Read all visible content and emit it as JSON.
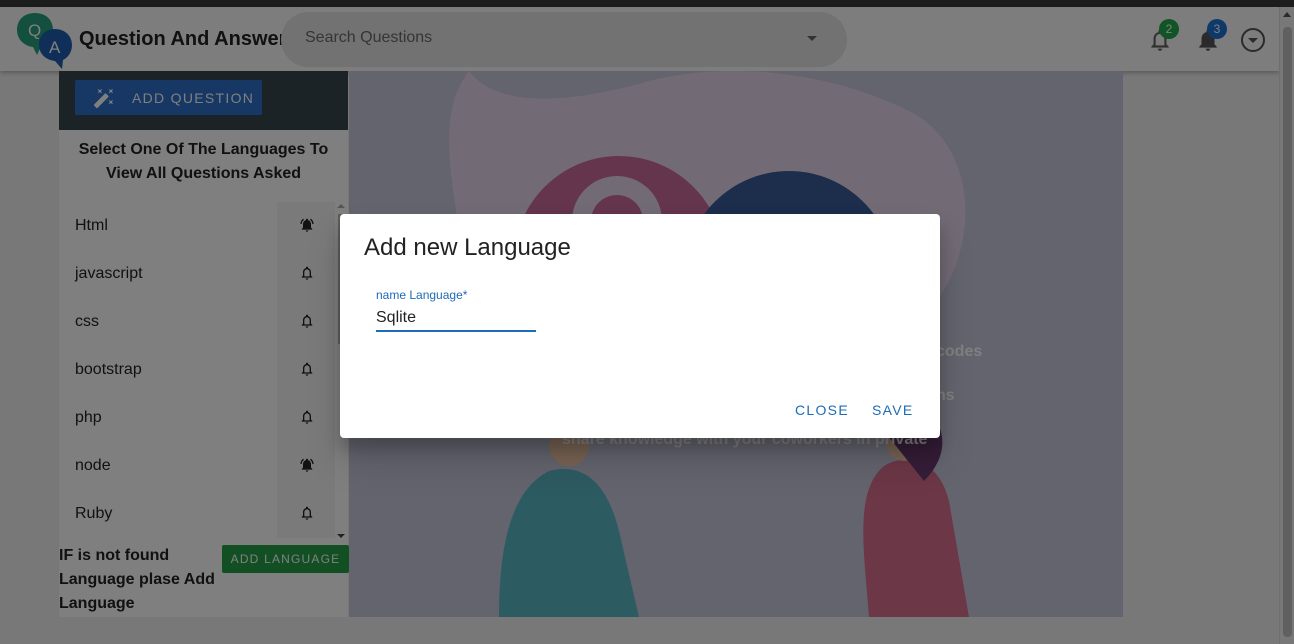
{
  "app": {
    "title": "Question And Answer",
    "logo_letters": [
      "Q",
      "A"
    ]
  },
  "search": {
    "placeholder": "Search Questions"
  },
  "notifications": [
    {
      "icon": "bell-outline-icon",
      "count": "2",
      "badge_color": "#22a84a"
    },
    {
      "icon": "bell-icon",
      "count": "3",
      "badge_color": "#1e73d2"
    }
  ],
  "sidebar": {
    "add_question_label": "ADD QUESTION",
    "heading": "Select One Of The Languages To View All Questions Asked",
    "languages": [
      {
        "name": "Html",
        "bell": "bell-ringing-icon"
      },
      {
        "name": "javascript",
        "bell": "bell-outline-icon"
      },
      {
        "name": "css",
        "bell": "bell-outline-icon"
      },
      {
        "name": "bootstrap",
        "bell": "bell-outline-icon"
      },
      {
        "name": "php",
        "bell": "bell-outline-icon"
      },
      {
        "name": "node",
        "bell": "bell-ringing-icon"
      },
      {
        "name": "Ruby",
        "bell": "bell-outline-icon"
      }
    ],
    "not_found_text": "IF is not found Language plase Add Language",
    "add_language_label": "ADD LANGUAGE"
  },
  "hero": {
    "line1": "codes",
    "line2": "ns",
    "line3": "share knowledge with your coworkers in private"
  },
  "dialog": {
    "title": "Add new Language",
    "field_label": "name Language*",
    "field_value": "Sqlite",
    "close_label": "CLOSE",
    "save_label": "SAVE"
  },
  "colors": {
    "primary": "#1e6bb8",
    "add_question_bg": "#2e6fc8",
    "add_language_bg": "#24a148",
    "sidebar_header_bg": "#38474f"
  }
}
